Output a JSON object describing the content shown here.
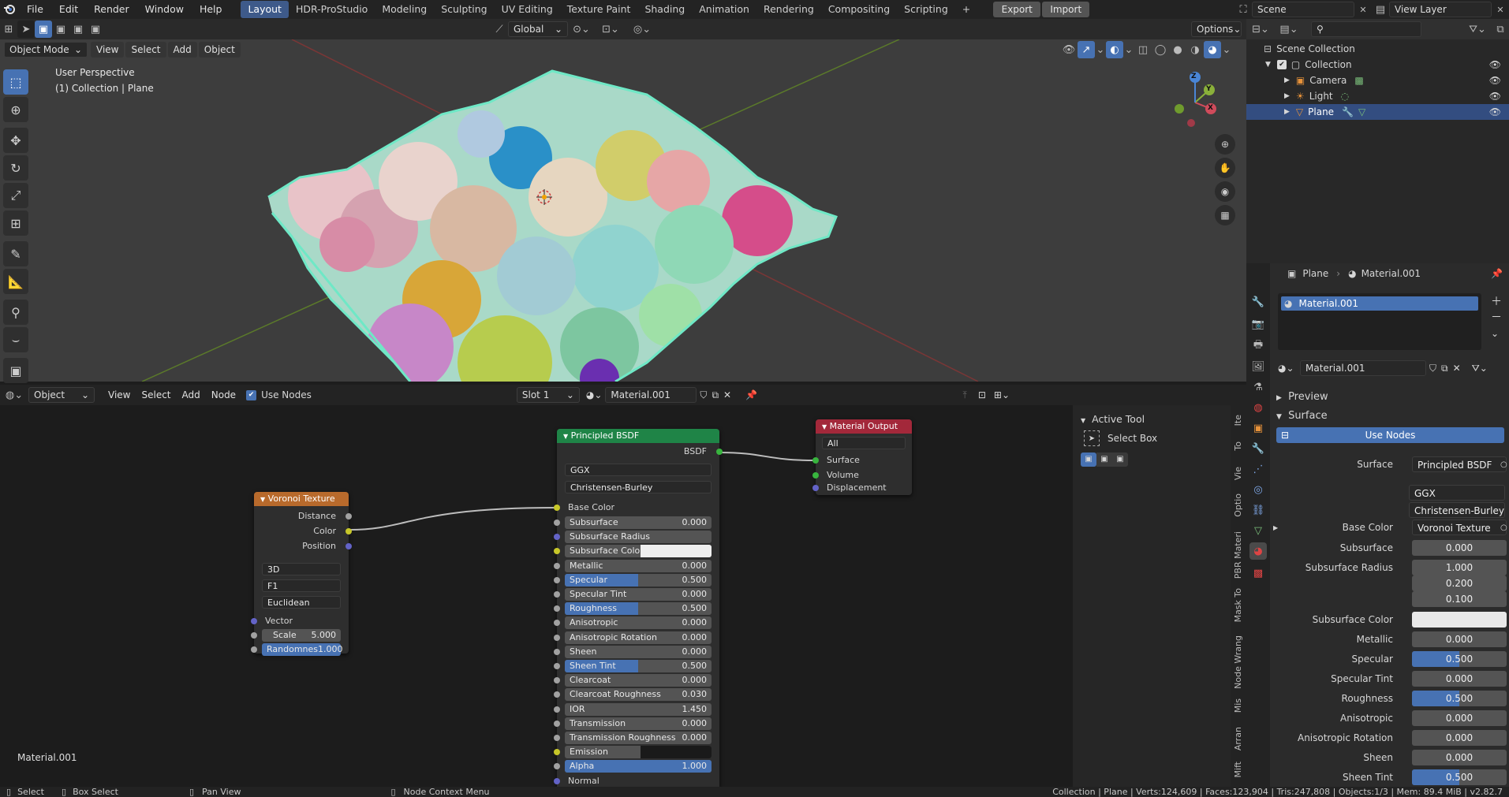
{
  "topbar": {
    "menus": [
      "File",
      "Edit",
      "Render",
      "Window",
      "Help"
    ],
    "workspaces": [
      "Layout",
      "HDR-ProStudio",
      "Modeling",
      "Sculpting",
      "UV Editing",
      "Texture Paint",
      "Shading",
      "Animation",
      "Rendering",
      "Compositing",
      "Scripting"
    ],
    "active_workspace": "Layout",
    "add_tab": "+",
    "export": "Export",
    "import": "Import",
    "scene": "Scene",
    "view_layer": "View Layer"
  },
  "viewport_header": {
    "mode": "Object Mode",
    "menus": [
      "View",
      "Select",
      "Add",
      "Object"
    ],
    "transform": "Global",
    "options": "Options"
  },
  "viewport": {
    "perspective": "User Perspective",
    "collection_info": "(1) Collection | Plane",
    "gizmo_x": "X",
    "gizmo_y": "Y",
    "gizmo_z": "Z"
  },
  "outliner": {
    "search_placeholder": "",
    "items": [
      {
        "label": "Scene Collection",
        "indent": 0
      },
      {
        "label": "Collection",
        "indent": 1
      },
      {
        "label": "Camera",
        "indent": 2
      },
      {
        "label": "Light",
        "indent": 2
      },
      {
        "label": "Plane",
        "indent": 2,
        "selected": true
      }
    ]
  },
  "props_header": {
    "object": "Plane",
    "material": "Material.001",
    "slot_item": "Material.001",
    "material_field": "Material.001"
  },
  "props": {
    "preview": "Preview",
    "surface_panel": "Surface",
    "use_nodes": "Use Nodes",
    "surface_label": "Surface",
    "surface_value": "Principled BSDF",
    "distribution": "GGX",
    "subsurface_method": "Christensen-Burley",
    "base_color_label": "Base Color",
    "base_color_value": "Voronoi Texture",
    "subsurface_label": "Subsurface",
    "subsurface_value": "0.000",
    "subsurface_radius_label": "Subsurface Radius",
    "subsurface_radius": [
      "1.000",
      "0.200",
      "0.100"
    ],
    "subsurface_color_label": "Subsurface Color",
    "metallic_label": "Metallic",
    "metallic_value": "0.000",
    "specular_label": "Specular",
    "specular_value": "0.500",
    "specular_tint_label": "Specular Tint",
    "specular_tint_value": "0.000",
    "roughness_label": "Roughness",
    "roughness_value": "0.500",
    "anisotropic_label": "Anisotropic",
    "anisotropic_value": "0.000",
    "aniso_rot_label": "Anisotropic Rotation",
    "aniso_rot_value": "0.000",
    "sheen_label": "Sheen",
    "sheen_value": "0.000",
    "sheen_tint_label": "Sheen Tint",
    "sheen_tint_value": "0.500"
  },
  "node_header": {
    "editor_type": "Object",
    "menus": [
      "View",
      "Select",
      "Add",
      "Node"
    ],
    "use_nodes": "Use Nodes",
    "slot": "Slot 1",
    "material": "Material.001"
  },
  "active_tool": {
    "title": "Active Tool",
    "tool": "Select Box"
  },
  "side_tabs": [
    "Ite",
    "To",
    "Vie",
    "Optio",
    "PBR Materi",
    "Mask To",
    "Node Wrang",
    "Mis",
    "Arran",
    "Mift"
  ],
  "node_editor": {
    "material_label": "Material.001",
    "voronoi": {
      "title": "Voronoi Texture",
      "outputs": [
        "Distance",
        "Color",
        "Position"
      ],
      "dim": "3D",
      "feature": "F1",
      "metric": "Euclidean",
      "vector": "Vector",
      "scale_label": "Scale",
      "scale_value": "5.000",
      "random_label": "Randomnes",
      "random_value": "1.000"
    },
    "bsdf": {
      "title": "Principled BSDF",
      "output": "BSDF",
      "distribution": "GGX",
      "subsurface_method": "Christensen-Burley",
      "base_color": "Base Color",
      "rows": [
        {
          "label": "Subsurface",
          "value": "0.000",
          "fill": 0,
          "sock": "#a1a1a1"
        },
        {
          "label": "Subsurface Radius",
          "value": "",
          "fill": 0,
          "sock": "#6363c7"
        },
        {
          "label": "Subsurface Color",
          "value": "",
          "fill": 0,
          "sock": "#c7c729",
          "swatch": true
        },
        {
          "label": "Metallic",
          "value": "0.000",
          "fill": 0,
          "sock": "#a1a1a1"
        },
        {
          "label": "Specular",
          "value": "0.500",
          "fill": 0.5,
          "sock": "#a1a1a1"
        },
        {
          "label": "Specular Tint",
          "value": "0.000",
          "fill": 0,
          "sock": "#a1a1a1"
        },
        {
          "label": "Roughness",
          "value": "0.500",
          "fill": 0.5,
          "sock": "#a1a1a1"
        },
        {
          "label": "Anisotropic",
          "value": "0.000",
          "fill": 0,
          "sock": "#a1a1a1"
        },
        {
          "label": "Anisotropic Rotation",
          "value": "0.000",
          "fill": 0,
          "sock": "#a1a1a1"
        },
        {
          "label": "Sheen",
          "value": "0.000",
          "fill": 0,
          "sock": "#a1a1a1"
        },
        {
          "label": "Sheen Tint",
          "value": "0.500",
          "fill": 0.5,
          "sock": "#a1a1a1"
        },
        {
          "label": "Clearcoat",
          "value": "0.000",
          "fill": 0,
          "sock": "#a1a1a1"
        },
        {
          "label": "Clearcoat Roughness",
          "value": "0.030",
          "fill": 0,
          "sock": "#a1a1a1"
        },
        {
          "label": "IOR",
          "value": "1.450",
          "fill": 0,
          "sock": "#a1a1a1"
        },
        {
          "label": "Transmission",
          "value": "0.000",
          "fill": 0,
          "sock": "#a1a1a1"
        },
        {
          "label": "Transmission Roughness",
          "value": "0.000",
          "fill": 0,
          "sock": "#a1a1a1"
        },
        {
          "label": "Emission",
          "value": "",
          "fill": 0,
          "sock": "#c7c729",
          "swatch_dark": true
        },
        {
          "label": "Alpha",
          "value": "1.000",
          "fill": 1,
          "sock": "#a1a1a1"
        },
        {
          "label": "Normal",
          "value": "",
          "fill": 0,
          "sock": "#6363c7",
          "plain": true
        }
      ]
    },
    "output": {
      "title": "Material Output",
      "target": "All",
      "inputs": [
        "Surface",
        "Volume",
        "Displacement"
      ]
    }
  },
  "status": {
    "select": "Select",
    "box_select": "Box Select",
    "pan_view": "Pan View",
    "context_menu": "Node Context Menu",
    "stats": "Collection | Plane | Verts:124,609 | Faces:123,904 | Tris:247,808 | Objects:1/3 | Mem: 89.4 MiB | v2.82.7"
  },
  "colors": {
    "accent": "#4772b3",
    "voronoi_header": "#b86a2c",
    "bsdf_header": "#1f8447",
    "output_header": "#a3283a"
  }
}
